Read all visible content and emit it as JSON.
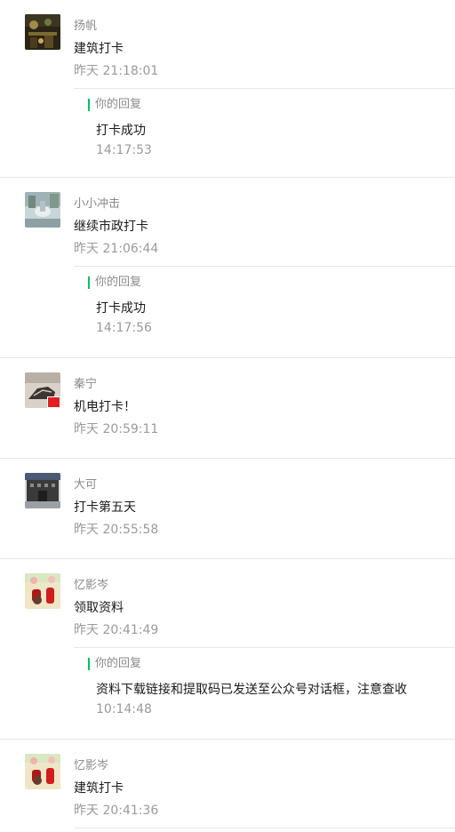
{
  "messages": [
    {
      "name": "扬帆",
      "text": "建筑打卡",
      "time": "昨天 21:18:01",
      "reply": {
        "tag": "你的回复",
        "text": "打卡成功",
        "time": "14:17:53"
      }
    },
    {
      "name": "小小冲击",
      "text": "继续市政打卡",
      "time": "昨天 21:06:44",
      "reply": {
        "tag": "你的回复",
        "text": "打卡成功",
        "time": "14:17:56"
      }
    },
    {
      "name": "秦宁",
      "text": "机电打卡！",
      "time": "昨天 20:59:11"
    },
    {
      "name": "大可",
      "text": "打卡第五天",
      "time": "昨天 20:55:58"
    },
    {
      "name": "忆影岑",
      "text": "领取资料",
      "time": "昨天 20:41:49",
      "reply": {
        "tag": "你的回复",
        "text": "资料下载链接和提取码已发送至公众号对话框，注意查收",
        "time": "10:14:48"
      }
    },
    {
      "name": "忆影岑",
      "text": "建筑打卡",
      "time": "昨天 20:41:36"
    }
  ]
}
